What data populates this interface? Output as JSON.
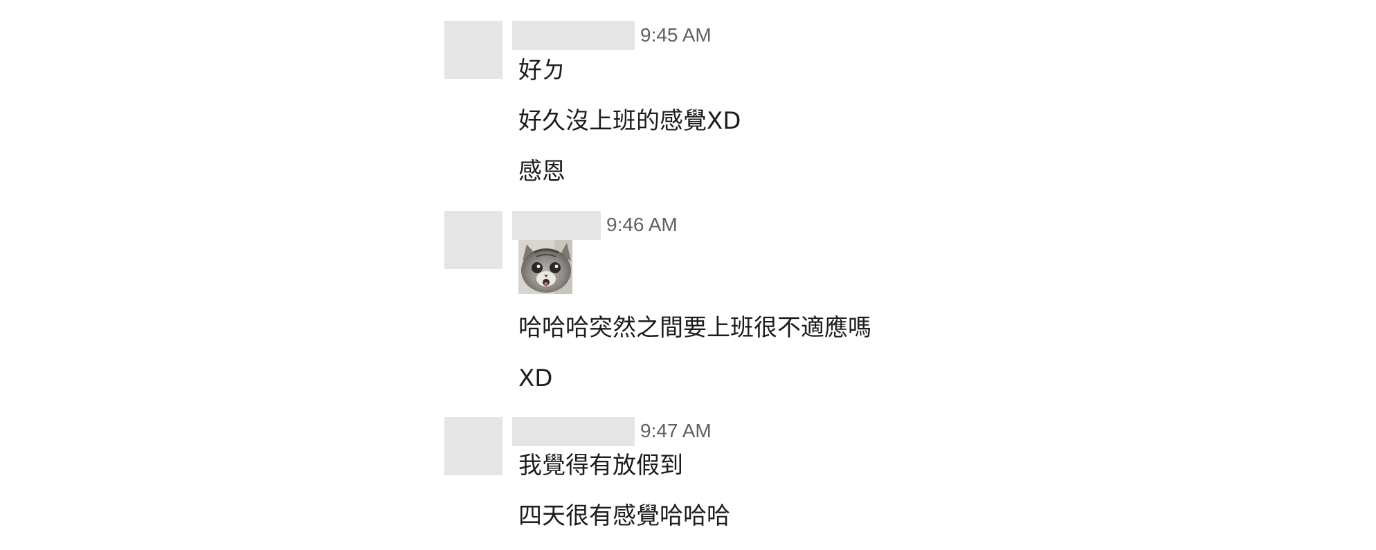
{
  "messages": [
    {
      "time": "9:45 AM",
      "lines": [
        "好ㄉ",
        "好久沒上班的感覺XD",
        "感恩"
      ]
    },
    {
      "time": "9:46 AM",
      "sticker": "surprised-cat-sticker",
      "lines": [
        "哈哈哈突然之間要上班很不適應嗎",
        "XD"
      ]
    },
    {
      "time": "9:47 AM",
      "lines": [
        "我覺得有放假到",
        "四天很有感覺哈哈哈"
      ]
    }
  ],
  "colors": {
    "placeholder": "#e5e5e5",
    "timestamp": "#616061",
    "text": "#1d1c1d",
    "background": "#ffffff"
  }
}
